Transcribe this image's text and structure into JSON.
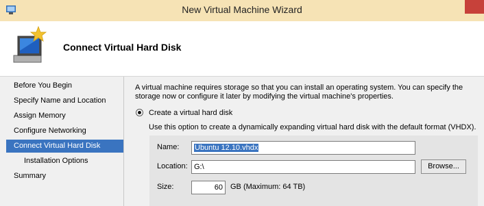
{
  "window": {
    "title": "New Virtual Machine Wizard"
  },
  "header": {
    "title": "Connect Virtual Hard Disk"
  },
  "nav": {
    "items": [
      {
        "label": "Before You Begin"
      },
      {
        "label": "Specify Name and Location"
      },
      {
        "label": "Assign Memory"
      },
      {
        "label": "Configure Networking"
      },
      {
        "label": "Connect Virtual Hard Disk",
        "active": true
      },
      {
        "label": "Installation Options",
        "sub": true
      },
      {
        "label": "Summary"
      }
    ]
  },
  "content": {
    "description": "A virtual machine requires storage so that you can install an operating system. You can specify the storage now or configure it later by modifying the virtual machine's properties.",
    "option_create": {
      "label": "Create a virtual hard disk",
      "selected": true,
      "description": "Use this option to create a dynamically expanding virtual hard disk with the default format (VHDX)."
    },
    "fields": {
      "name_label": "Name:",
      "name_value": "Ubuntu 12.10.vhdx",
      "location_label": "Location:",
      "location_value": "G:\\",
      "browse_label": "Browse...",
      "size_label": "Size:",
      "size_value": "60",
      "size_unit": "GB (Maximum: 64 TB)"
    }
  },
  "colors": {
    "titlebar": "#f6e3b5",
    "nav_active": "#3a74c0",
    "close_button": "#c7413a"
  },
  "icons": [
    "window-app-icon",
    "wizard-computer-icon",
    "close-icon"
  ]
}
